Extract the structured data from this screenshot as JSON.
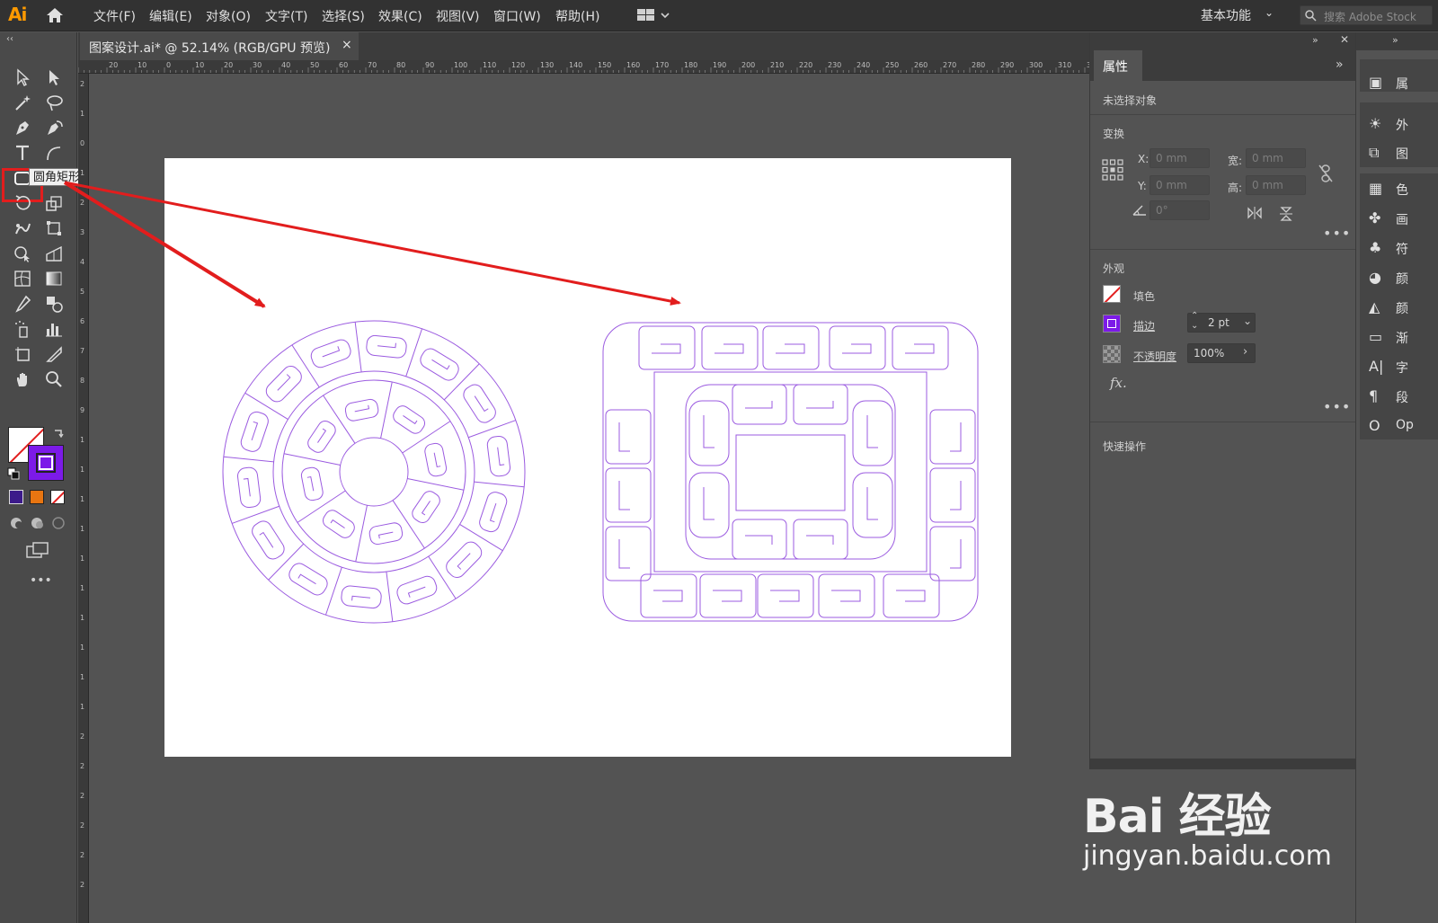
{
  "app": {
    "logo": "Ai"
  },
  "menu": [
    "文件(F)",
    "编辑(E)",
    "对象(O)",
    "文字(T)",
    "选择(S)",
    "效果(C)",
    "视图(V)",
    "窗口(W)",
    "帮助(H)"
  ],
  "workspace": {
    "label": "基本功能"
  },
  "search": {
    "placeholder": "搜索 Adobe Stock"
  },
  "document": {
    "tab_title": "图案设计.ai* @ 52.14% (RGB/GPU 预览)",
    "close": "×"
  },
  "toolbar": {
    "collapse": "‹‹",
    "tooltip": "圆角矩形工具",
    "more": "•••",
    "icons": [
      "selection-icon",
      "direct-selection-icon",
      "magic-wand-icon",
      "lasso-icon",
      "pen-icon",
      "curvature-icon",
      "type-icon",
      "arc-icon",
      "rounded-rectangle-icon",
      "paintbrush-icon",
      "rotate-icon",
      "scale-icon",
      "warp-icon",
      "free-transform-icon",
      "shape-builder-icon",
      "perspective-icon",
      "mesh-icon",
      "gradient-icon",
      "eyedropper-icon",
      "blend-icon",
      "symbol-sprayer-icon",
      "column-graph-icon",
      "artboard-icon",
      "slice-icon",
      "hand-icon",
      "zoom-icon"
    ]
  },
  "ruler_h": [
    "20",
    "10",
    "0",
    "10",
    "20",
    "30",
    "40",
    "50",
    "60",
    "70",
    "80",
    "90",
    "100",
    "110",
    "120",
    "130",
    "140",
    "150",
    "160",
    "170",
    "180",
    "190",
    "200",
    "210",
    "220",
    "230",
    "240",
    "250",
    "260",
    "270",
    "280",
    "290",
    "300",
    "310",
    "320"
  ],
  "ruler_v": [
    "2",
    "1",
    "0",
    "1",
    "2",
    "3",
    "4",
    "5",
    "6",
    "7",
    "8",
    "9",
    "1",
    "1",
    "1",
    "1",
    "1",
    "1",
    "1",
    "1",
    "1",
    "1",
    "2",
    "2",
    "2",
    "2",
    "2",
    "2"
  ],
  "properties": {
    "tab": "属性",
    "expand": "»",
    "no_selection": "未选择对象",
    "transform": {
      "title": "变换",
      "x_label": "X:",
      "x_value": "0 mm",
      "y_label": "Y:",
      "y_value": "0 mm",
      "w_label": "宽:",
      "w_value": "0 mm",
      "h_label": "高:",
      "h_value": "0 mm",
      "angle_value": "0°"
    },
    "appearance": {
      "title": "外观",
      "fill_label": "填色",
      "stroke_label": "描边",
      "stroke_value": "2 pt",
      "opacity_label": "不透明度",
      "opacity_value": "100%",
      "fx": "fx."
    },
    "quick_actions": "快速操作",
    "more": "•••"
  },
  "dock": {
    "items": [
      {
        "label": "属",
        "icon": "properties-icon"
      },
      {
        "label": "外",
        "icon": "appearance-icon"
      },
      {
        "label": "图",
        "icon": "layers-icon"
      },
      {
        "label": "色",
        "icon": "swatches-icon"
      },
      {
        "label": "画",
        "icon": "brushes-icon"
      },
      {
        "label": "符",
        "icon": "symbols-icon"
      },
      {
        "label": "颜",
        "icon": "color-icon"
      },
      {
        "label": "颜",
        "icon": "color-guide-icon"
      },
      {
        "label": "渐",
        "icon": "gradient-panel-icon"
      },
      {
        "label": "字",
        "icon": "character-icon"
      },
      {
        "label": "段",
        "icon": "paragraph-icon"
      },
      {
        "label": "Op",
        "icon": "opentype-icon"
      }
    ]
  },
  "colors": {
    "stroke": "#7c1ae8",
    "artwork": "#9b5be0",
    "annotation": "#e21d1d",
    "fill_swatch_3": "#e87511"
  },
  "watermark": {
    "brand": "Bai 经验",
    "url": "jingyan.baidu.com"
  }
}
